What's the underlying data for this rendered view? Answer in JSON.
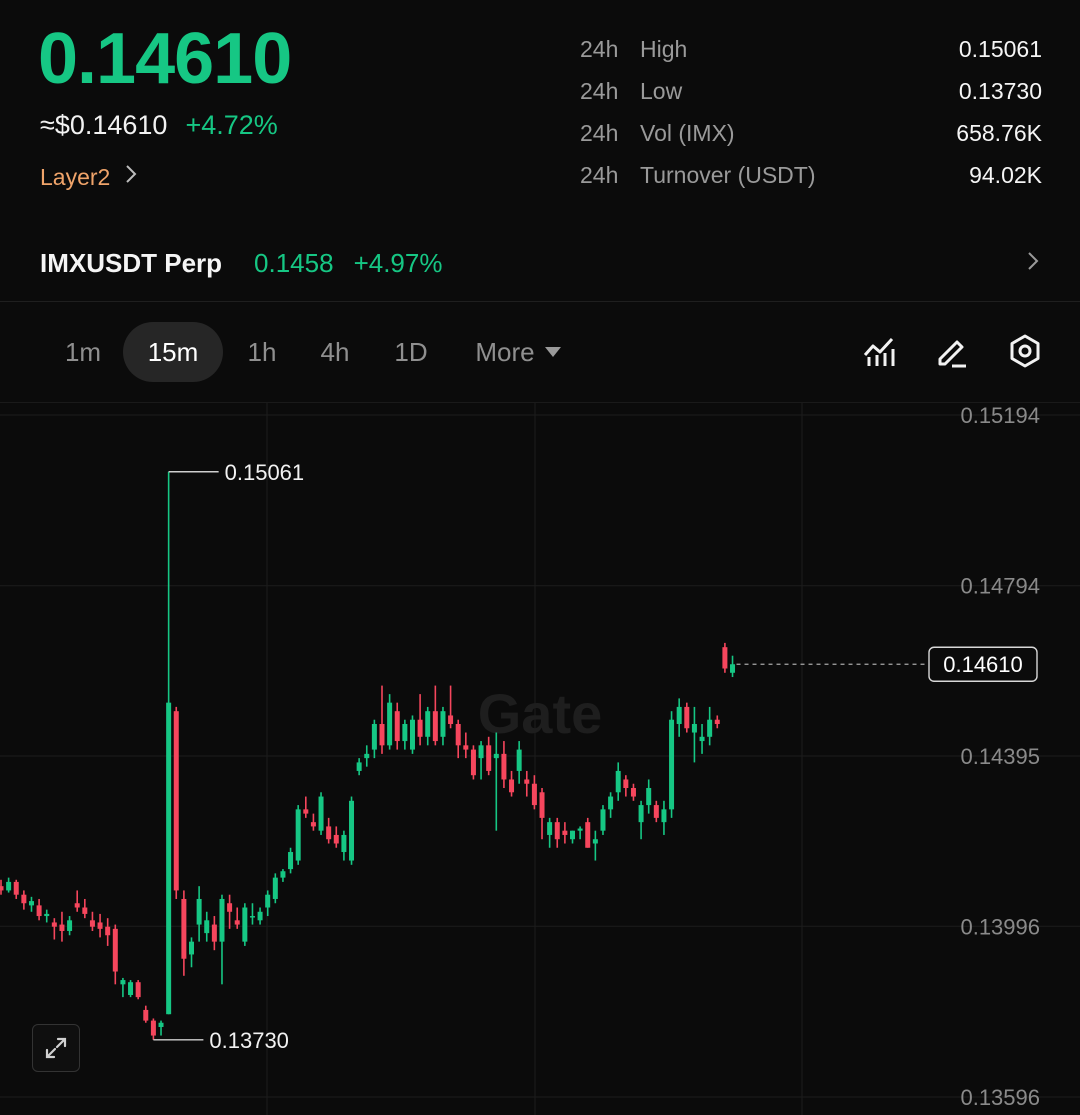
{
  "ticker": {
    "price": "0.14610",
    "usd_price": "≈$0.14610",
    "change": "+4.72%",
    "tag": "Layer2"
  },
  "stats": [
    {
      "period": "24h",
      "label": "High",
      "value": "0.15061"
    },
    {
      "period": "24h",
      "label": "Low",
      "value": "0.13730"
    },
    {
      "period": "24h",
      "label": "Vol (IMX)",
      "value": "658.76K"
    },
    {
      "period": "24h",
      "label": "Turnover (USDT)",
      "value": "94.02K"
    }
  ],
  "perp": {
    "name": "IMXUSDT Perp",
    "price": "0.1458",
    "change": "+4.97%"
  },
  "timeframes": {
    "items": [
      "1m",
      "15m",
      "1h",
      "4h",
      "1D"
    ],
    "active": "15m",
    "more_label": "More"
  },
  "toolbar": {
    "icons": [
      "indicator-icon",
      "draw-icon",
      "settings-icon"
    ]
  },
  "colors": {
    "up": "#16c784",
    "down": "#f6465d",
    "accent": "#f0a46a"
  },
  "chart_data": {
    "type": "candlestick",
    "interval": "15m",
    "watermark": "Gate",
    "ylim": [
      0.13596,
      0.15194
    ],
    "y_ticks": [
      "0.15194",
      "0.14794",
      "0.14395",
      "0.13996",
      "0.13596"
    ],
    "high_marker": "0.15061",
    "low_marker": "0.13730",
    "last_price": "0.14610",
    "candles": [
      [
        0.1409,
        0.14105,
        0.1407,
        0.1408
      ],
      [
        0.1408,
        0.1411,
        0.14075,
        0.141
      ],
      [
        0.141,
        0.14105,
        0.1406,
        0.1407
      ],
      [
        0.1407,
        0.1408,
        0.14035,
        0.1405
      ],
      [
        0.14045,
        0.14065,
        0.1403,
        0.14055
      ],
      [
        0.14045,
        0.1406,
        0.1401,
        0.1402
      ],
      [
        0.1402,
        0.14035,
        0.14005,
        0.14025
      ],
      [
        0.14005,
        0.14015,
        0.13965,
        0.13995
      ],
      [
        0.14,
        0.1403,
        0.1396,
        0.13985
      ],
      [
        0.13985,
        0.1402,
        0.13975,
        0.1401
      ],
      [
        0.1405,
        0.1408,
        0.1403,
        0.1404
      ],
      [
        0.1404,
        0.1406,
        0.14015,
        0.14025
      ],
      [
        0.1401,
        0.1403,
        0.13985,
        0.13995
      ],
      [
        0.14005,
        0.14025,
        0.1397,
        0.1399
      ],
      [
        0.13995,
        0.14015,
        0.1395,
        0.13975
      ],
      [
        0.1399,
        0.14,
        0.1386,
        0.1389
      ],
      [
        0.1386,
        0.13875,
        0.1383,
        0.1387
      ],
      [
        0.13835,
        0.1387,
        0.1383,
        0.13865
      ],
      [
        0.13865,
        0.1387,
        0.13825,
        0.1383
      ],
      [
        0.138,
        0.1381,
        0.1377,
        0.13775
      ],
      [
        0.13775,
        0.1378,
        0.1373,
        0.1374
      ],
      [
        0.1376,
        0.13775,
        0.1374,
        0.1377
      ],
      [
        0.1379,
        0.15061,
        0.1379,
        0.1452
      ],
      [
        0.145,
        0.1451,
        0.1406,
        0.1408
      ],
      [
        0.1406,
        0.1408,
        0.1388,
        0.1392
      ],
      [
        0.1393,
        0.1397,
        0.139,
        0.1396
      ],
      [
        0.14,
        0.1409,
        0.1396,
        0.1406
      ],
      [
        0.1398,
        0.1403,
        0.1396,
        0.1401
      ],
      [
        0.14,
        0.1402,
        0.1394,
        0.1396
      ],
      [
        0.1396,
        0.1407,
        0.1386,
        0.1406
      ],
      [
        0.1405,
        0.1407,
        0.1399,
        0.1403
      ],
      [
        0.1401,
        0.1404,
        0.1399,
        0.14
      ],
      [
        0.1396,
        0.1405,
        0.1395,
        0.1404
      ],
      [
        0.1402,
        0.1405,
        0.14,
        0.1402
      ],
      [
        0.1401,
        0.1404,
        0.14,
        0.1403
      ],
      [
        0.1404,
        0.1408,
        0.1402,
        0.1407
      ],
      [
        0.1406,
        0.1412,
        0.1405,
        0.1411
      ],
      [
        0.1411,
        0.1413,
        0.141,
        0.14125
      ],
      [
        0.1413,
        0.1418,
        0.1412,
        0.1417
      ],
      [
        0.1415,
        0.1428,
        0.1414,
        0.1427
      ],
      [
        0.1427,
        0.143,
        0.1425,
        0.1426
      ],
      [
        0.1424,
        0.1426,
        0.1422,
        0.1423
      ],
      [
        0.1422,
        0.1431,
        0.1421,
        0.143
      ],
      [
        0.1423,
        0.1425,
        0.1419,
        0.142
      ],
      [
        0.1421,
        0.1423,
        0.1418,
        0.1419
      ],
      [
        0.1417,
        0.1422,
        0.1415,
        0.1421
      ],
      [
        0.1415,
        0.143,
        0.1414,
        0.1429
      ],
      [
        0.1436,
        0.1439,
        0.1435,
        0.1438
      ],
      [
        0.1439,
        0.1442,
        0.1437,
        0.144
      ],
      [
        0.1441,
        0.1448,
        0.1439,
        0.1447
      ],
      [
        0.1447,
        0.1456,
        0.144,
        0.1442
      ],
      [
        0.1442,
        0.1454,
        0.1441,
        0.1452
      ],
      [
        0.145,
        0.1452,
        0.1441,
        0.1443
      ],
      [
        0.1443,
        0.1448,
        0.1441,
        0.1447
      ],
      [
        0.1441,
        0.1449,
        0.144,
        0.1448
      ],
      [
        0.1448,
        0.1454,
        0.1442,
        0.1444
      ],
      [
        0.1444,
        0.1451,
        0.1442,
        0.145
      ],
      [
        0.145,
        0.1456,
        0.1442,
        0.1443
      ],
      [
        0.1444,
        0.1451,
        0.1442,
        0.145
      ],
      [
        0.1449,
        0.1456,
        0.1446,
        0.1447
      ],
      [
        0.1447,
        0.1448,
        0.1439,
        0.1442
      ],
      [
        0.1442,
        0.1445,
        0.1439,
        0.1441
      ],
      [
        0.1441,
        0.1442,
        0.1434,
        0.1435
      ],
      [
        0.1439,
        0.1443,
        0.1434,
        0.1442
      ],
      [
        0.1442,
        0.1444,
        0.1435,
        0.1436
      ],
      [
        0.1439,
        0.1445,
        0.1422,
        0.144
      ],
      [
        0.144,
        0.1443,
        0.1432,
        0.1434
      ],
      [
        0.1434,
        0.1436,
        0.143,
        0.1431
      ],
      [
        0.1436,
        0.1443,
        0.1433,
        0.1441
      ],
      [
        0.1434,
        0.1436,
        0.143,
        0.1433
      ],
      [
        0.1433,
        0.1435,
        0.1427,
        0.1428
      ],
      [
        0.1431,
        0.1432,
        0.142,
        0.1425
      ],
      [
        0.1421,
        0.1425,
        0.1418,
        0.1424
      ],
      [
        0.1424,
        0.1425,
        0.1418,
        0.142
      ],
      [
        0.1422,
        0.1424,
        0.1419,
        0.1421
      ],
      [
        0.142,
        0.1422,
        0.1419,
        0.1422
      ],
      [
        0.1422,
        0.1423,
        0.142,
        0.14225
      ],
      [
        0.1424,
        0.1425,
        0.1418,
        0.1418
      ],
      [
        0.1419,
        0.1422,
        0.1415,
        0.142
      ],
      [
        0.1422,
        0.1428,
        0.1421,
        0.1427
      ],
      [
        0.1427,
        0.1431,
        0.1425,
        0.143
      ],
      [
        0.1431,
        0.1438,
        0.1429,
        0.1436
      ],
      [
        0.1434,
        0.1435,
        0.143,
        0.1432
      ],
      [
        0.1432,
        0.1433,
        0.1429,
        0.143
      ],
      [
        0.1424,
        0.1429,
        0.142,
        0.1428
      ],
      [
        0.1428,
        0.1434,
        0.1426,
        0.1432
      ],
      [
        0.1428,
        0.1429,
        0.1424,
        0.1425
      ],
      [
        0.1424,
        0.1429,
        0.1421,
        0.1427
      ],
      [
        0.1427,
        0.145,
        0.1425,
        0.1448
      ],
      [
        0.1447,
        0.1453,
        0.1444,
        0.1451
      ],
      [
        0.1451,
        0.1452,
        0.1445,
        0.1446
      ],
      [
        0.1445,
        0.1451,
        0.1438,
        0.1447
      ],
      [
        0.1443,
        0.1447,
        0.144,
        0.1444
      ],
      [
        0.1444,
        0.1451,
        0.1442,
        0.1448
      ],
      [
        0.1448,
        0.1449,
        0.1446,
        0.1447
      ],
      [
        0.1465,
        0.1466,
        0.1459,
        0.146
      ],
      [
        0.1459,
        0.1463,
        0.1458,
        0.1461
      ]
    ]
  }
}
